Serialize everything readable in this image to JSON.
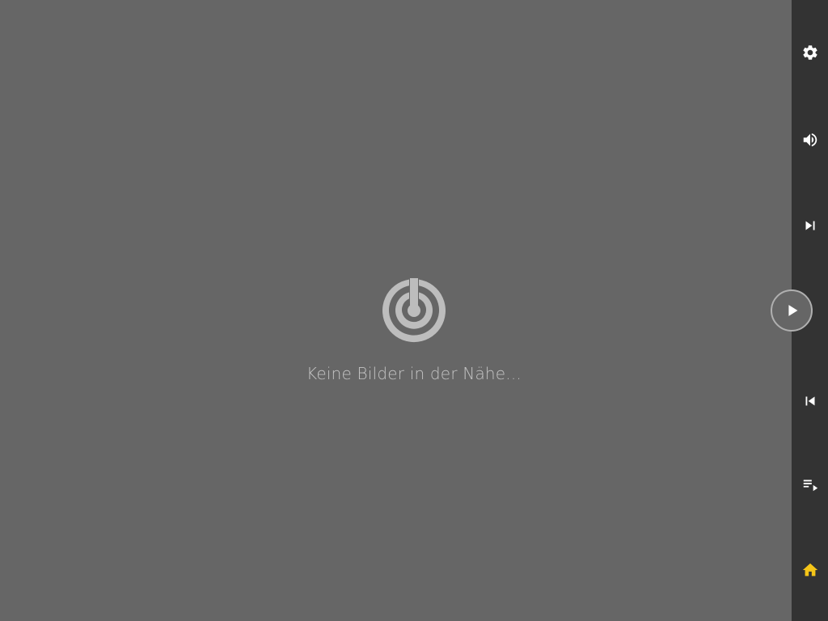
{
  "main": {
    "empty_message": "Keine Bilder in der Nähe...",
    "empty_icon": "radar-icon"
  },
  "rail": {
    "buttons": [
      {
        "name": "settings",
        "icon": "gear-icon"
      },
      {
        "name": "volume",
        "icon": "volume-icon"
      },
      {
        "name": "skip-next",
        "icon": "skip-next-icon"
      },
      {
        "name": "play",
        "icon": "play-icon"
      },
      {
        "name": "skip-previous",
        "icon": "skip-previous-icon"
      },
      {
        "name": "playlist",
        "icon": "playlist-icon"
      },
      {
        "name": "home",
        "icon": "home-icon",
        "active": true
      }
    ]
  },
  "colors": {
    "background": "#666666",
    "rail_background": "#333333",
    "icon_light": "#ffffff",
    "icon_muted": "#bdbdbd",
    "text_muted": "#c4c4c4",
    "accent": "#f5c518",
    "play_ring": "#b0b0b0"
  }
}
